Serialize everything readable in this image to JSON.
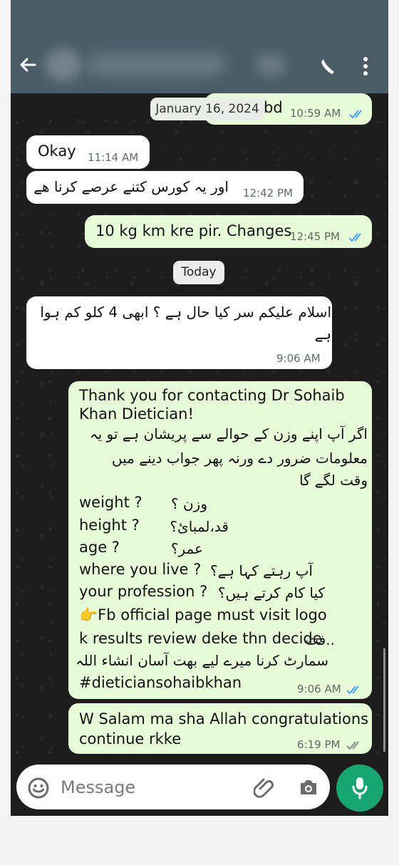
{
  "header": {
    "back_icon": "arrow-left-icon",
    "call_icon": "phone-icon",
    "menu_icon": "dots-vertical-icon"
  },
  "dates": {
    "top": "January 16, 2024",
    "today": "Today"
  },
  "messages": [
    {
      "id": "m1",
      "side": "outgoing",
      "lines": [
        "bd"
      ],
      "time": "10:59 AM",
      "status": "read"
    },
    {
      "id": "m2",
      "side": "incoming",
      "lines": [
        "Okay"
      ],
      "time": "11:14 AM"
    },
    {
      "id": "m3",
      "side": "incoming",
      "lines": [
        "اور یہ کورس کتنے عرصے کرنا ھے"
      ],
      "time": "12:42 PM"
    },
    {
      "id": "m4",
      "side": "outgoing",
      "lines": [
        "10 kg km kre pir. Changes"
      ],
      "time": "12:45 PM",
      "status": "read"
    },
    {
      "id": "m5",
      "side": "incoming",
      "lines": [
        "اسلام علیکم سر کیا حال ہے ؟ ابھی 4 کلو کم ہوا",
        "ہے"
      ],
      "time": "9:06 AM"
    },
    {
      "id": "m6",
      "side": "outgoing",
      "lines": [
        "Thank you for contacting Dr Sohaib",
        "Khan Dietician!",
        "اگر آپ اپنے وزن کے حوالے سے پریشان ہے تو یہ",
        "معلومات ضرور دے ورنہ پھر جواب دینے میں",
        "وقت لگے گا",
        "weight ?",
        "وزن ؟",
        "height ?",
        "قد،لمبائ؟",
        "age ?",
        "عمر؟",
        "where you live ?",
        "آپ رہتے کہا ہے؟",
        "your profession ?",
        "کیا کام کرتے ہیں؟",
        "👉Fb official page must visit logo",
        "k results review deke thn decide",
        "..فٹ",
        "سمارٹ کرنا میرے لیے بھت آسان انشاء اللہ",
        "#dieticiansohaibkhan"
      ],
      "time": "9:06 AM",
      "status": "read"
    },
    {
      "id": "m7",
      "side": "outgoing",
      "lines": [
        "W Salam ma sha Allah congratulations",
        "continue rkke"
      ],
      "time": "6:19 PM",
      "status": "delivered"
    }
  ],
  "composer": {
    "placeholder": "Message",
    "emoji_icon": "emoji-icon",
    "attach_icon": "paperclip-icon",
    "camera_icon": "camera-icon",
    "mic_icon": "microphone-icon"
  },
  "colors": {
    "header": "#4b5c67",
    "incoming": "#ffffff",
    "outgoing": "#e7fbd8",
    "accent": "#18a574",
    "read_ticks": "#4ca3ff"
  }
}
